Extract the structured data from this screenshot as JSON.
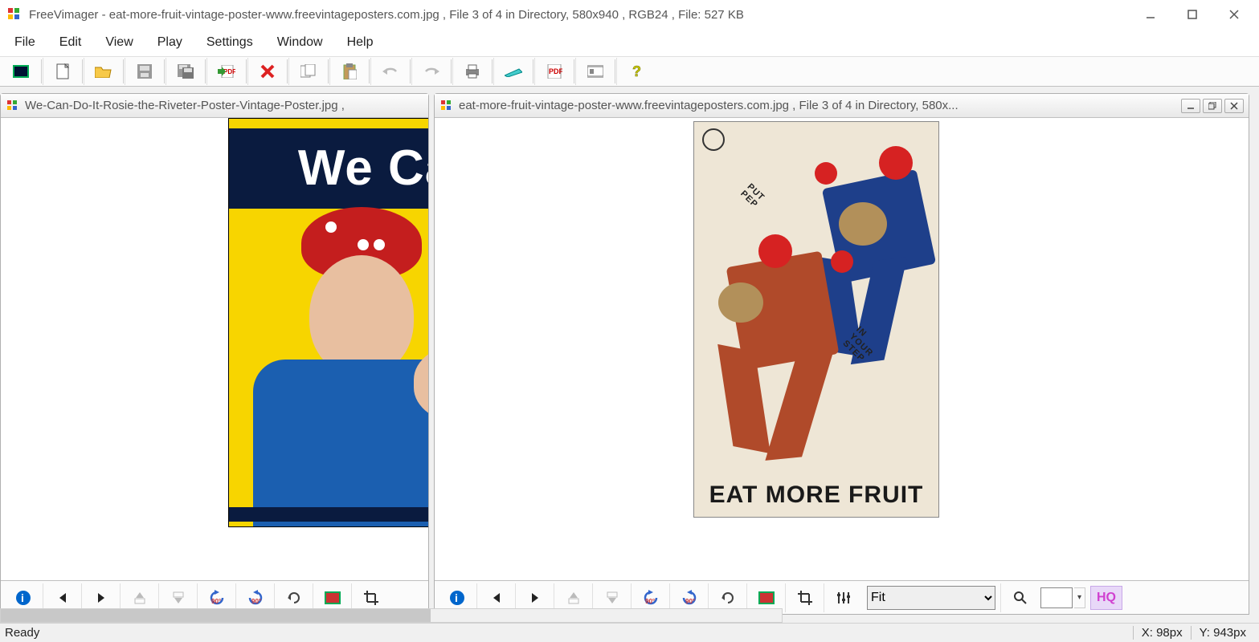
{
  "app": {
    "name": "FreeVimager",
    "title_suffix": " - eat-more-fruit-vintage-poster-www.freevintageposters.com.jpg , File 3 of 4 in Directory, 580x940 , RGB24 , File: 527 KB"
  },
  "menu": [
    "File",
    "Edit",
    "View",
    "Play",
    "Settings",
    "Window",
    "Help"
  ],
  "toolbar_icons": [
    "fullscreen-icon",
    "new-icon",
    "open-icon",
    "save-icon",
    "save-as-icon",
    "pdf-export-icon",
    "delete-icon",
    "copy-icon",
    "paste-icon",
    "undo-icon",
    "redo-icon",
    "print-icon",
    "scan-icon",
    "pdf-icon",
    "slideshow-icon",
    "help-icon"
  ],
  "documents": {
    "left": {
      "title": "We-Can-Do-It-Rosie-the-Riveter-Poster-Vintage-Poster.jpg ,",
      "poster_text": "We Can D"
    },
    "right": {
      "title": "eat-more-fruit-vintage-poster-www.freevintageposters.com.jpg , File 3 of 4 in Directory, 580x...",
      "zoom": "Fit",
      "hq_label": "HQ",
      "poster_caption": "EAT MORE FRUIT",
      "poster_text_pep": "PUT\nPEP",
      "poster_text_step": "IN\nYOUR\nSTEP"
    }
  },
  "doc_toolbar_icons": [
    "info-icon",
    "prev-icon",
    "next-icon",
    "move-up-icon",
    "move-down-icon",
    "rotate-ccw-icon",
    "rotate-cw-icon",
    "refresh-icon",
    "fit-screen-icon",
    "crop-icon",
    "adjust-icon"
  ],
  "status": {
    "left": "Ready",
    "coord_x": "X: 98px",
    "coord_y": "Y: 943px"
  }
}
